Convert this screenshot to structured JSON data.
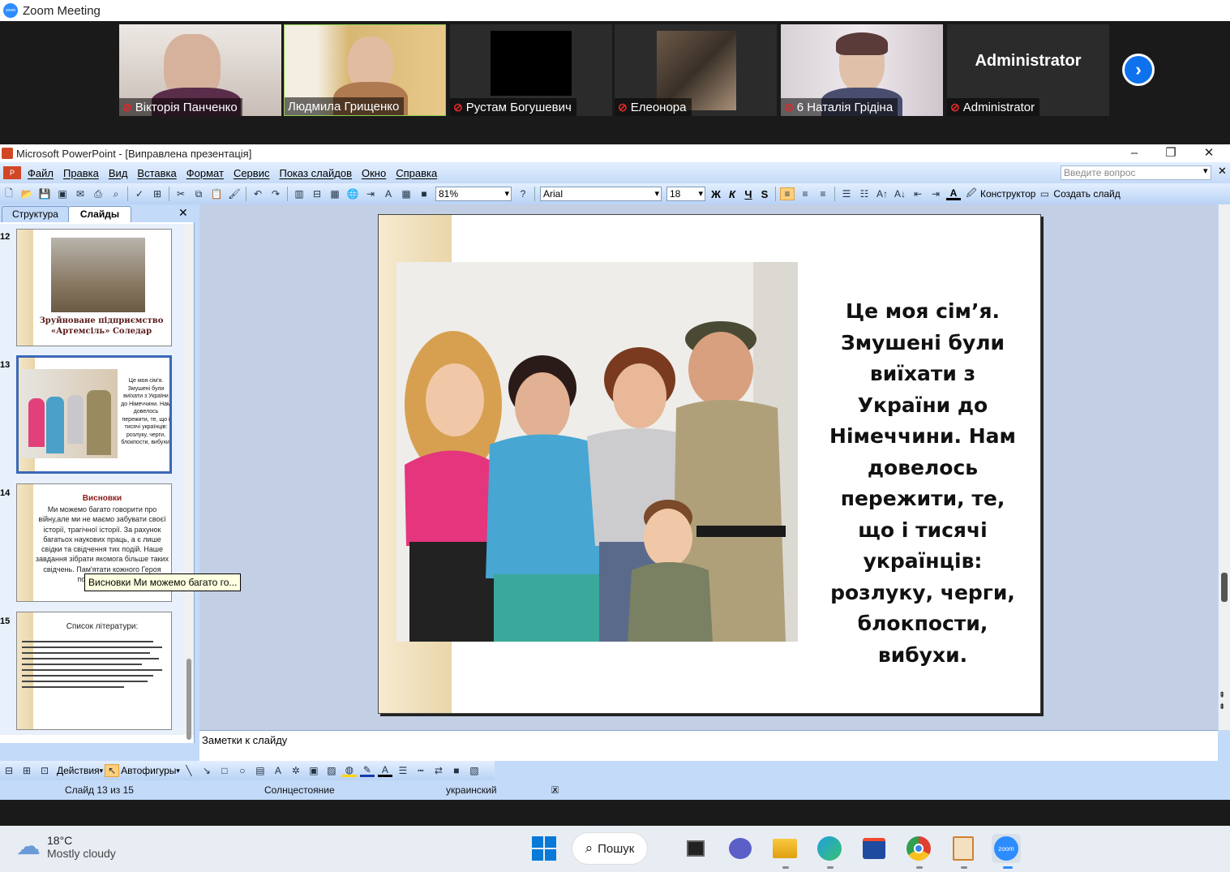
{
  "zoom": {
    "window_title": "Zoom Meeting",
    "participants": [
      {
        "name": "Вікторія Панченко",
        "muted": true
      },
      {
        "name": "Людмила Грищенко",
        "muted": false
      },
      {
        "name": "Рустам Богушевич",
        "muted": true
      },
      {
        "name": "Елеонора",
        "muted": true
      },
      {
        "name": "6 Наталія Грідіна",
        "muted": true
      },
      {
        "name": "Administrator",
        "muted": true,
        "avatar_text": "Administrator"
      }
    ]
  },
  "ppt": {
    "title": "Microsoft PowerPoint - [Виправлена презентація]",
    "menu": [
      "Файл",
      "Правка",
      "Вид",
      "Вставка",
      "Формат",
      "Сервис",
      "Показ слайдов",
      "Окно",
      "Справка"
    ],
    "help_placeholder": "Введите вопрос",
    "zoom_level": "81%",
    "font_name": "Arial",
    "font_size": "18",
    "bold": "Ж",
    "italic": "К",
    "underline": "Ч",
    "shadow": "S",
    "designer": "Конструктор",
    "new_slide": "Создать слайд",
    "tabs": {
      "outline": "Структура",
      "slides": "Слайды"
    },
    "thumbnails": [
      {
        "number": "12",
        "caption": "Зруйноване підприємство «Артемсіль» Соледар"
      },
      {
        "number": "13",
        "caption": "Це моя сім'я. Змушені були виїхати з України до Німеччини. Нам довелось пережити, те, що і тисячі українців: розлуку, черги, блокпости, вибухи."
      },
      {
        "number": "14",
        "title": "Висновки",
        "caption": "Ми можемо багато говорити про війну,але ми не маємо забувати своєї історії, трагічної історії. За рахунок багатьох наукових праць, а є лише свідки та свідчення тих подій. Наше завдання зібрати якомога більше таких свідчень. Пам'ятати кожного Героя поіменно, які..."
      },
      {
        "number": "15",
        "title": "Список літератури:"
      }
    ],
    "tooltip": "Висновки Ми можемо багато го...",
    "slide_text": "Це моя сім’я. Змушені були виїхати з України до Німеччини. Нам довелось пережити, те, що і тисячі українців: розлуку, черги, блокпости, вибухи.",
    "notes_placeholder": "Заметки к слайду",
    "draw": {
      "actions": "Действия",
      "autoshapes": "Автофигуры"
    },
    "status": {
      "slide": "Слайд 13 из 15",
      "theme": "Солнцестояние",
      "language": "украинский"
    }
  },
  "taskbar": {
    "temperature": "18°C",
    "weather": "Mostly cloudy",
    "search": "Пошук"
  }
}
